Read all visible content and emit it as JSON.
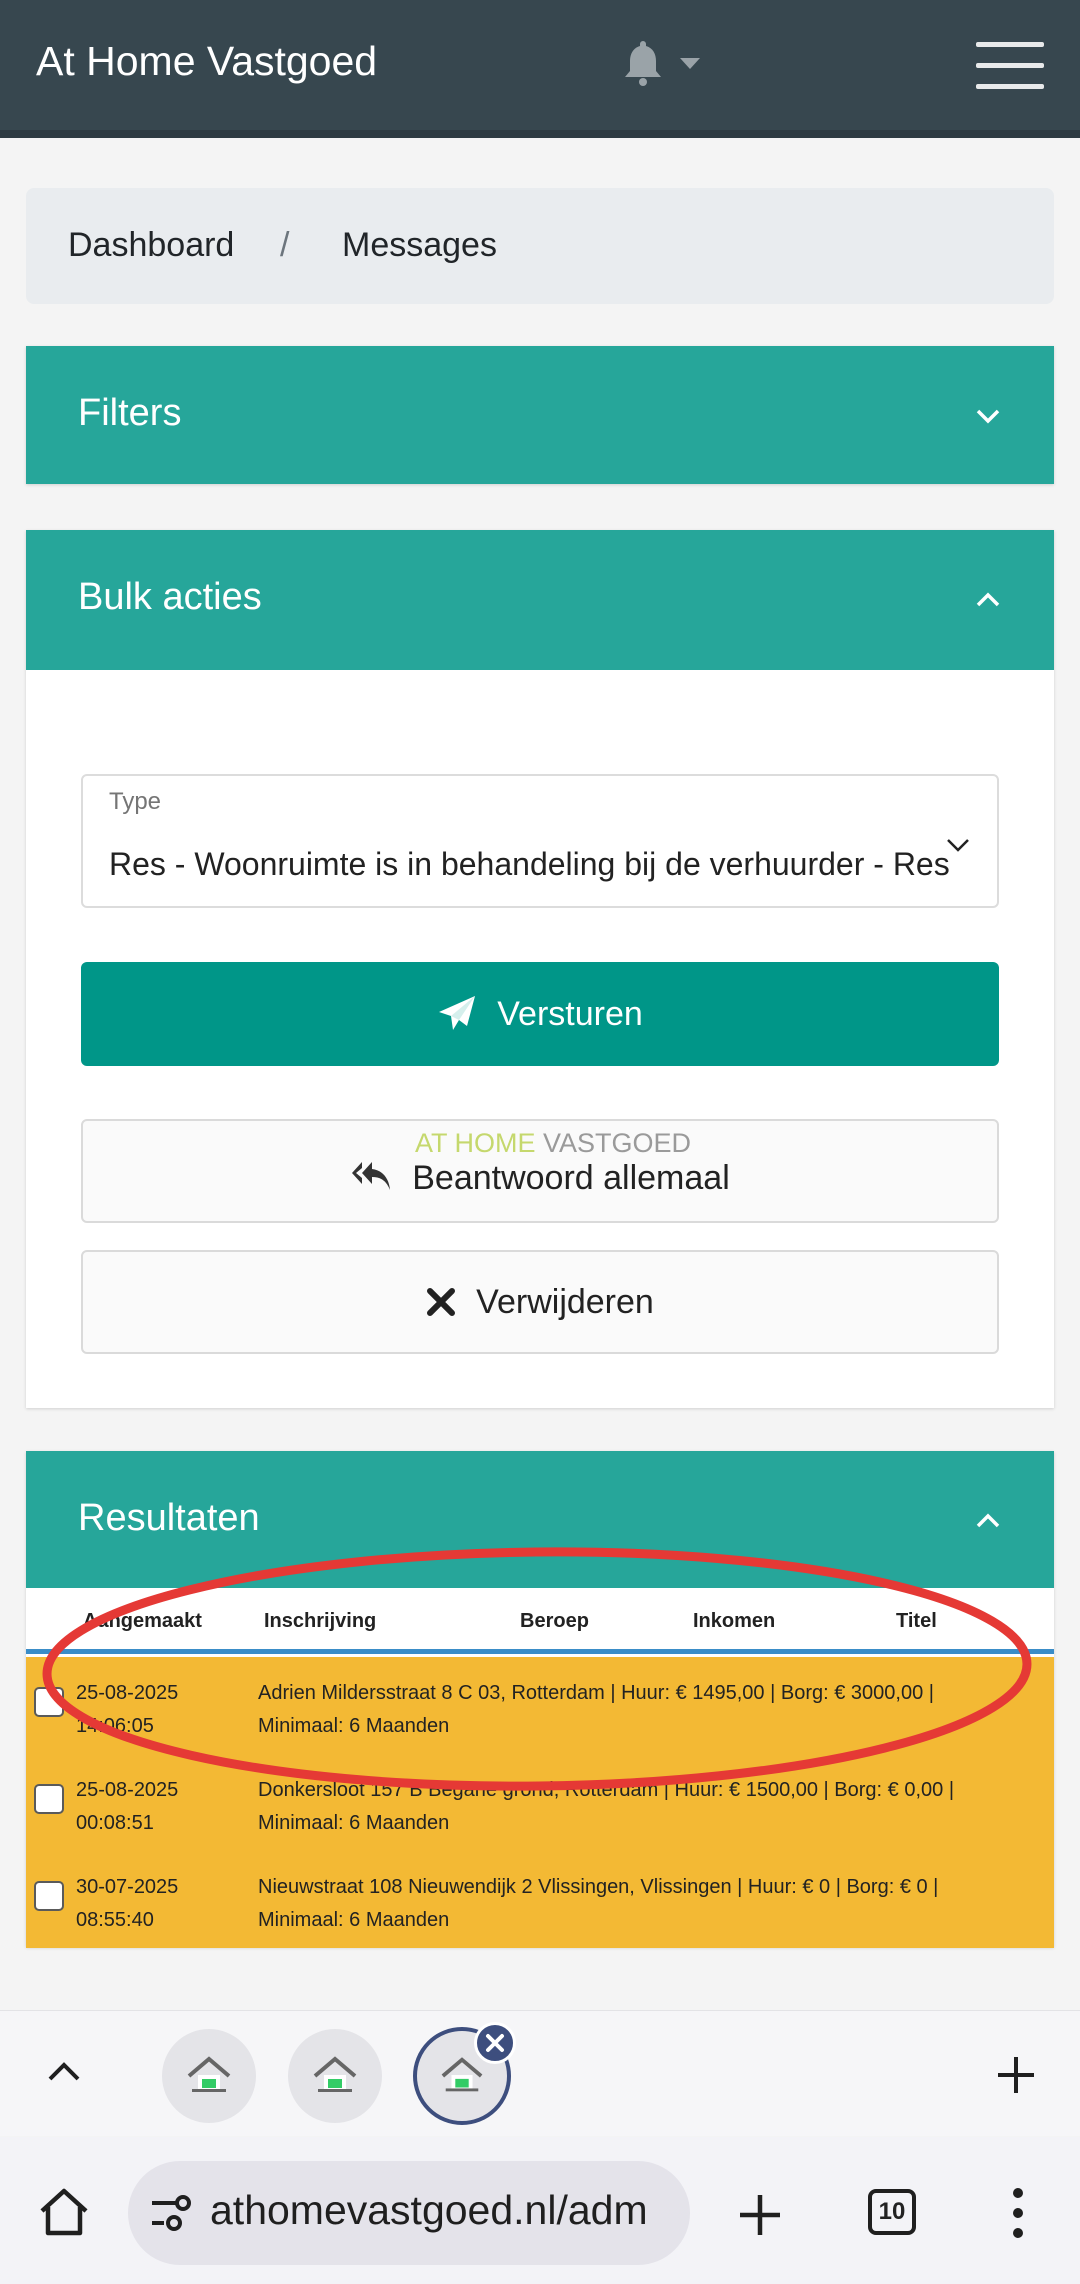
{
  "app": {
    "title": "At Home Vastgoed"
  },
  "breadcrumb": {
    "items": [
      "Dashboard",
      "Messages"
    ],
    "separator": "/"
  },
  "filters": {
    "title": "Filters"
  },
  "bulk": {
    "title": "Bulk acties",
    "type_label": "Type",
    "type_value": "Res - Woonruimte is in behandeling bij de verhuurder - Res",
    "send_label": "Versturen",
    "reply_all_label": "Beantwoord allemaal",
    "delete_label": "Verwijderen",
    "watermark_1": "AT HOME ",
    "watermark_2": "VASTGOED"
  },
  "results": {
    "title": "Resultaten",
    "columns": [
      "Aangemaakt",
      "Inschrijving",
      "Beroep",
      "Inkomen",
      "Titel"
    ],
    "rows": [
      {
        "date": "25-08-2025",
        "time": "14:06:05",
        "line1": "Adrien Mildersstraat 8 C 03, Rotterdam | Huur: € 1495,00 | Borg: € 3000,00 |",
        "line2": "Minimaal: 6 Maanden"
      },
      {
        "date": "25-08-2025",
        "time": "00:08:51",
        "line1": "Donkersloot 157 B Begane grond, Rotterdam | Huur: € 1500,00 | Borg: € 0,00 |",
        "line2": "Minimaal: 6 Maanden"
      },
      {
        "date": "30-07-2025",
        "time": "08:55:40",
        "line1": "Nieuwstraat 108 Nieuwendijk 2 Vlissingen, Vlissingen | Huur: € 0 | Borg: € 0 |",
        "line2": "Minimaal: 6 Maanden"
      }
    ]
  },
  "browser": {
    "url": "athomevastgoed.nl/adm",
    "tab_count": "10"
  },
  "colors": {
    "header": "#37474f",
    "teal": "#26a69a",
    "primary_button": "#009688",
    "row_highlight": "#f3b934",
    "annotation": "#e53935"
  }
}
